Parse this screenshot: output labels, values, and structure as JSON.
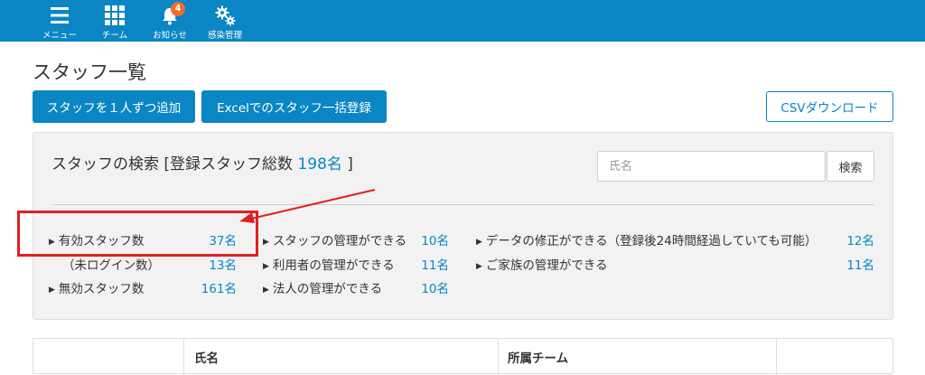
{
  "nav": {
    "items": [
      {
        "label": "メニュー",
        "icon": "menu-icon"
      },
      {
        "label": "チーム",
        "icon": "grid-icon"
      },
      {
        "label": "お知らせ",
        "icon": "bell-icon",
        "badge": "4"
      },
      {
        "label": "感染管理",
        "icon": "gears-icon"
      }
    ]
  },
  "page": {
    "title": "スタッフ一覧"
  },
  "actions": {
    "add_one": "スタッフを１人ずつ追加",
    "bulk_excel": "Excelでのスタッフ一括登録",
    "csv_download": "CSVダウンロード"
  },
  "search": {
    "title_prefix": "スタッフの検索 [登録スタッフ総数 ",
    "total": "198名",
    "title_suffix": " ]",
    "placeholder": "氏名",
    "button": "検索"
  },
  "stats": {
    "active_label": "有効スタッフ数",
    "active_value": "37名",
    "not_logged_in_label": "（未ログイン数）",
    "not_logged_in_value": "13名",
    "inactive_label": "無効スタッフ数",
    "inactive_value": "161名",
    "manage_staff_label": "スタッフの管理ができる",
    "manage_staff_value": "10名",
    "manage_users_label": "利用者の管理ができる",
    "manage_users_value": "11名",
    "manage_corp_label": "法人の管理ができる",
    "manage_corp_value": "10名",
    "edit_data_label": "データの修正ができる（登録後24時間経過していても可能）",
    "edit_data_value": "12名",
    "manage_family_label": "ご家族の管理ができる",
    "manage_family_value": "11名"
  },
  "table": {
    "headers": [
      "",
      "氏名",
      "所属チーム",
      ""
    ]
  },
  "colors": {
    "brand": "#0a86c4",
    "badge": "#f26c2e",
    "annotation": "#e02020"
  }
}
